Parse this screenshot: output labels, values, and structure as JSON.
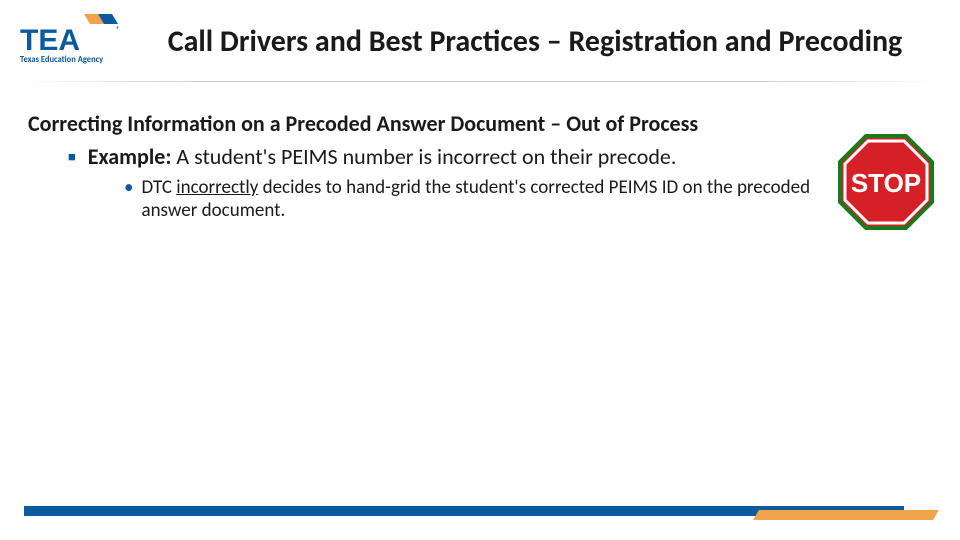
{
  "logo": {
    "primary_text": "TEA",
    "sub_text": "Texas Education Agency",
    "reg_mark": "®",
    "colors": {
      "blue": "#0b5aa0",
      "orange": "#f2a24a"
    }
  },
  "title": "Call Drivers and Best Practices – Registration and Precoding",
  "section_heading": "Correcting Information on a Precoded Answer Document – Out of Process",
  "bullet_l1": {
    "lead": "Example:",
    "rest": "  A student's PEIMS number is incorrect on their precode."
  },
  "bullet_l2": {
    "pre": "DTC ",
    "underlined": "incorrectly",
    "post": " decides to hand-grid the student's corrected PEIMS ID on the precoded answer document."
  },
  "stop_sign": {
    "label": "STOP",
    "fill": "#d62027",
    "stroke": "#1a7a1a"
  }
}
